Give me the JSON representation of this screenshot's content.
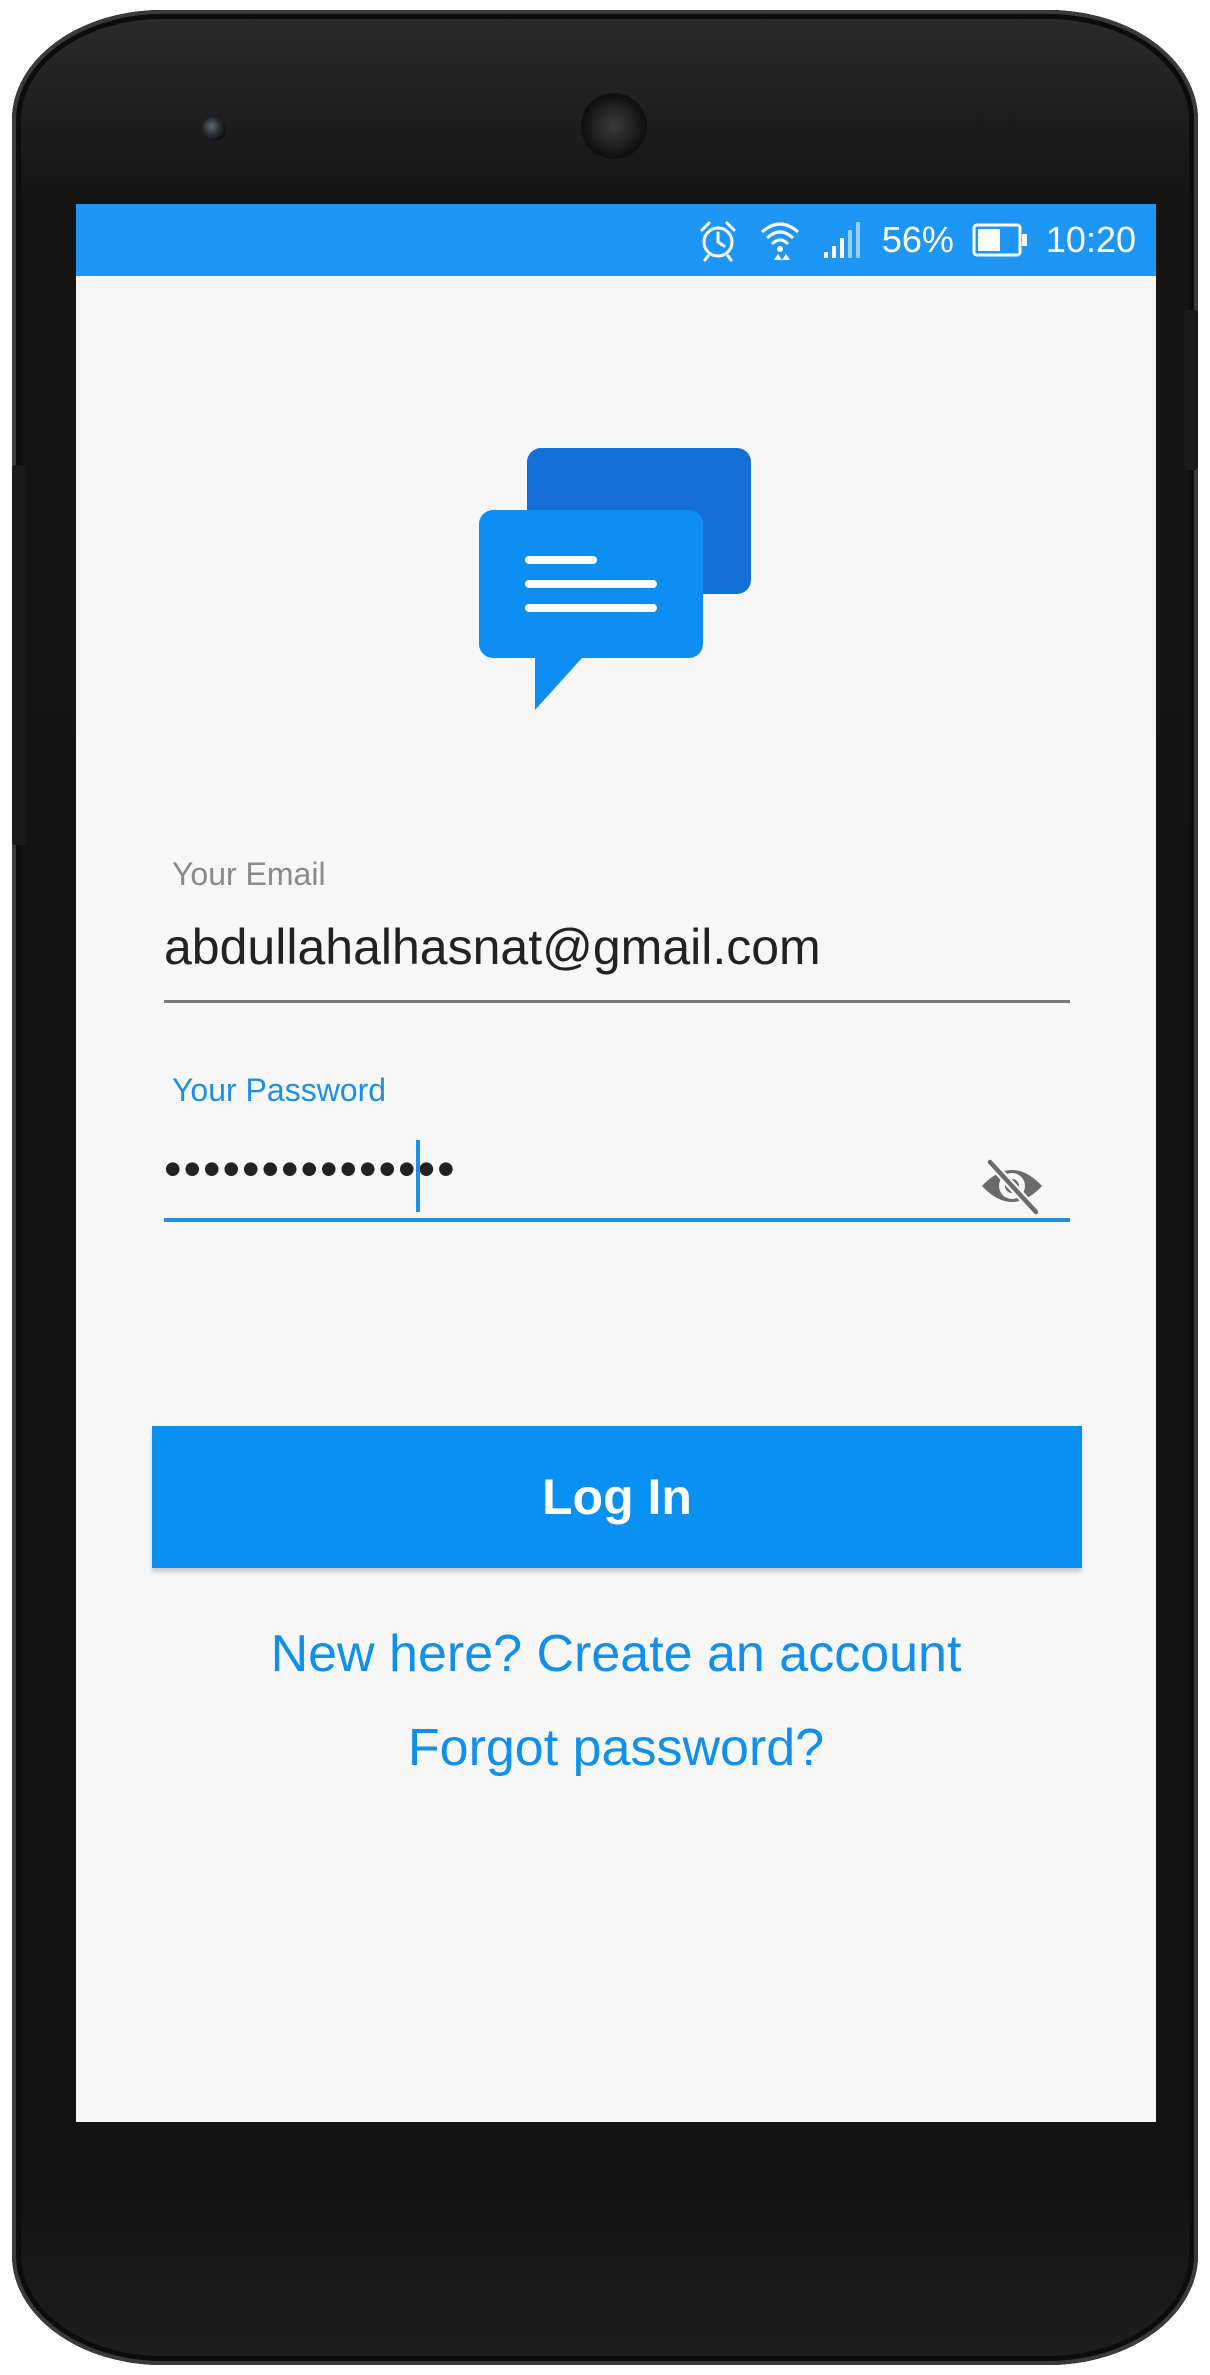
{
  "status_bar": {
    "battery_percent": "56%",
    "time": "10:20",
    "icons": [
      "alarm-icon",
      "wifi-icon",
      "signal-icon",
      "battery-icon"
    ],
    "color": "#1e96f5"
  },
  "logo": {
    "icon": "chat-bubbles-icon",
    "colors": [
      "#1470d6",
      "#0c8ef2"
    ]
  },
  "email": {
    "label": "Your Email",
    "value": "abdullahalhasnat@gmail.com"
  },
  "password": {
    "label": "Your Password",
    "masked_value": "•••••••••••••••",
    "toggle_icon": "eye-off-icon"
  },
  "login_button": {
    "label": "Log In",
    "color": "#0890f2"
  },
  "links": {
    "create_account": "New here? Create an account",
    "forgot_password": "Forgot password?"
  }
}
